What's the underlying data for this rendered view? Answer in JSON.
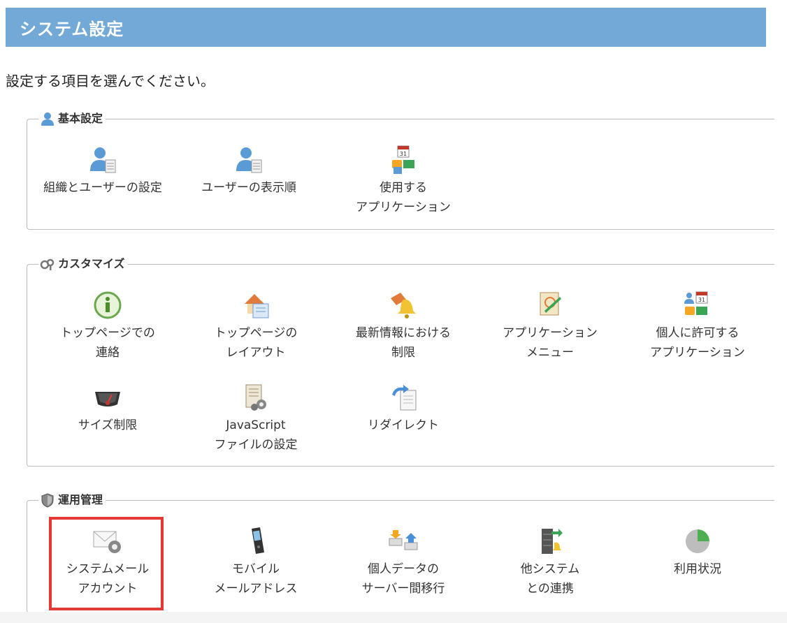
{
  "header": {
    "title": "システム設定"
  },
  "intro": "設定する項目を選んでください。",
  "sections": [
    {
      "title": "基本設定",
      "icon": "user-icon",
      "items": [
        {
          "label": "組織とユーザーの設定",
          "icon": "user-list-icon"
        },
        {
          "label": "ユーザーの表示順",
          "icon": "user-list-icon"
        },
        {
          "label": "使用する\nアプリケーション",
          "icon": "applications-icon"
        }
      ]
    },
    {
      "title": "カスタマイズ",
      "icon": "customize-icon",
      "items": [
        {
          "label": "トップページでの\n連絡",
          "icon": "info-icon"
        },
        {
          "label": "トップページの\nレイアウト",
          "icon": "home-layout-icon"
        },
        {
          "label": "最新情報における\n制限",
          "icon": "bell-restriction-icon"
        },
        {
          "label": "アプリケーション\nメニュー",
          "icon": "app-menu-icon"
        },
        {
          "label": "個人に許可する\nアプリケーション",
          "icon": "personal-apps-icon"
        },
        {
          "label": "サイズ制限",
          "icon": "gauge-icon"
        },
        {
          "label": "JavaScript\nファイルの設定",
          "icon": "script-file-icon"
        },
        {
          "label": "リダイレクト",
          "icon": "redirect-icon"
        }
      ]
    },
    {
      "title": "運用管理",
      "icon": "shield-icon",
      "items": [
        {
          "label": "システムメール\nアカウント",
          "icon": "mail-gear-icon"
        },
        {
          "label": "モバイル\nメールアドレス",
          "icon": "mobile-phone-icon"
        },
        {
          "label": "個人データの\nサーバー間移行",
          "icon": "data-transfer-icon"
        },
        {
          "label": "他システム\nとの連携",
          "icon": "server-link-icon"
        },
        {
          "label": "利用状況",
          "icon": "pie-chart-icon"
        }
      ]
    }
  ],
  "colors": {
    "header": "#72a9d6",
    "highlight": "#e53935"
  }
}
